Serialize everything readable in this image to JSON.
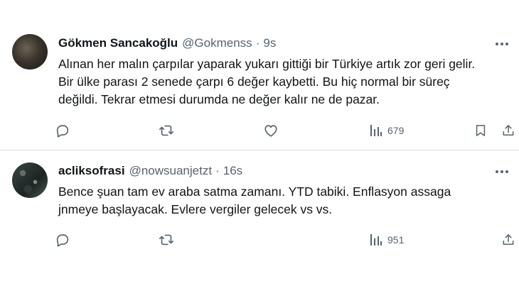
{
  "tweets": [
    {
      "name": "Gökmen Sancakoğlu",
      "handle": "@Gokmenss",
      "separator": "·",
      "time": "9s",
      "lines": [
        "Alınan her malın çarpılar yaparak yukarı gittiği bir Türkiye artık zor geri gelir.",
        "Bir ülke parası 2 senede çarpı 6 değer kaybetti. Bu hiç normal bir süreç",
        "değildi. Tekrar etmesi durumda ne değer kalır ne de pazar."
      ],
      "views": "679",
      "icons": [
        "reply-icon",
        "retweet-icon",
        "like-icon",
        "views-icon",
        "bookmark-icon",
        "share-icon"
      ]
    },
    {
      "name": "acliksofrasi",
      "handle": "@nowsuanjetzt",
      "separator": "·",
      "time": "16s",
      "lines": [
        "Bence şuan tam ev araba satma zamanı. YTD tabiki. Enflasyon assaga",
        "jnmeye başlayacak. Evlere vergiler gelecek vs vs."
      ],
      "views": "951",
      "icons": [
        "reply-icon",
        "retweet-icon",
        "views-icon",
        "share-icon"
      ]
    }
  ],
  "colors": {
    "text": "#0f1419",
    "secondary": "#536471",
    "divider": "#d6dbe0",
    "background": "#ffffff"
  }
}
